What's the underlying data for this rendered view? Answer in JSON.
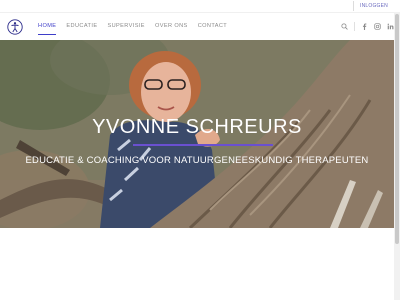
{
  "topbar": {
    "login_label": "INLOGGEN"
  },
  "header": {
    "logo": "person-figure-logo",
    "nav": [
      {
        "label": "HOME",
        "active": true
      },
      {
        "label": "EDUCATIE",
        "active": false
      },
      {
        "label": "SUPERVISIE",
        "active": false
      },
      {
        "label": "OVER ONS",
        "active": false
      },
      {
        "label": "CONTACT",
        "active": false
      }
    ],
    "icons": [
      "search-icon",
      "facebook-icon",
      "instagram-icon",
      "linkedin-icon"
    ],
    "accent_color": "#3e3ec9"
  },
  "hero": {
    "title": "YVONNE SCHREURS",
    "subtitle": "EDUCATIE & COACHING VOOR NATUURGENEESKUNDIG THERAPEUTEN",
    "divider_color": "#6a50d0"
  }
}
